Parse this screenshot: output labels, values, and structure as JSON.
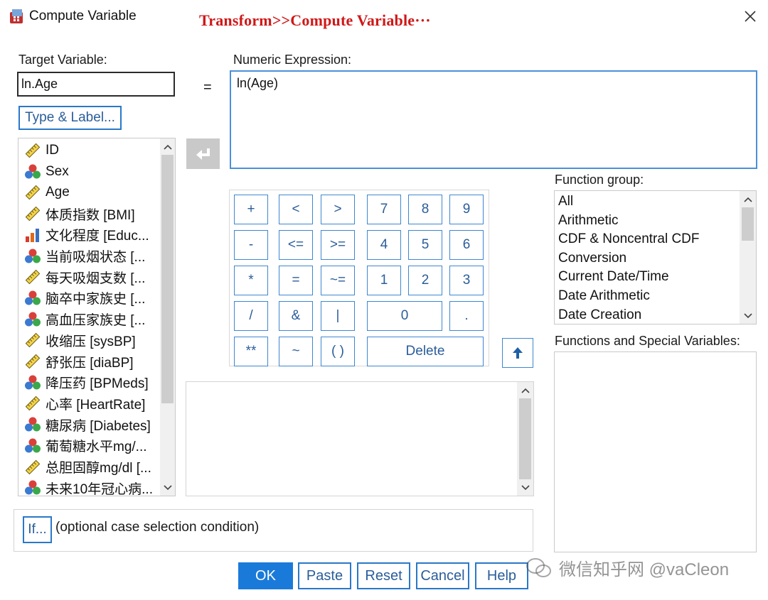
{
  "window": {
    "title": "Compute Variable",
    "annotation": "Transform>>Compute Variable···"
  },
  "target": {
    "label": "Target Variable:",
    "value": "ln.Age",
    "type_label_button": "Type & Label..."
  },
  "equals": "=",
  "expression": {
    "label": "Numeric Expression:",
    "value": "ln(Age)"
  },
  "variables": [
    {
      "label": "ID",
      "icon": "scale-ruler-icon"
    },
    {
      "label": "Sex",
      "icon": "nominal-circles-icon"
    },
    {
      "label": "Age",
      "icon": "scale-ruler-icon"
    },
    {
      "label": "体质指数 [BMI]",
      "icon": "scale-ruler-icon"
    },
    {
      "label": "文化程度 [Educ...",
      "icon": "ordinal-bars-icon"
    },
    {
      "label": "当前吸烟状态 [...",
      "icon": "nominal-circles-icon"
    },
    {
      "label": "每天吸烟支数 [...",
      "icon": "scale-ruler-icon"
    },
    {
      "label": "脑卒中家族史 [...",
      "icon": "nominal-circles-icon"
    },
    {
      "label": "高血压家族史 [...",
      "icon": "nominal-circles-icon"
    },
    {
      "label": "收缩压 [sysBP]",
      "icon": "scale-ruler-icon"
    },
    {
      "label": "舒张压 [diaBP]",
      "icon": "scale-ruler-icon"
    },
    {
      "label": "降压药 [BPMeds]",
      "icon": "nominal-circles-icon"
    },
    {
      "label": "心率 [HeartRate]",
      "icon": "scale-ruler-icon"
    },
    {
      "label": "糖尿病 [Diabetes]",
      "icon": "nominal-circles-icon"
    },
    {
      "label": "葡萄糖水平mg/...",
      "icon": "nominal-circles-icon"
    },
    {
      "label": "总胆固醇mg/dl [...",
      "icon": "scale-ruler-icon"
    },
    {
      "label": "未来10年冠心病...",
      "icon": "nominal-circles-icon"
    }
  ],
  "keypad": {
    "rows": [
      [
        "+",
        "<",
        ">",
        "7",
        "8",
        "9"
      ],
      [
        "-",
        "<=",
        ">=",
        "4",
        "5",
        "6"
      ],
      [
        "*",
        "=",
        "~=",
        "1",
        "2",
        "3"
      ],
      [
        "/",
        "&",
        "|",
        "0",
        "."
      ],
      [
        "**",
        "~",
        "( )",
        "Delete"
      ]
    ]
  },
  "function_group": {
    "label": "Function group:",
    "items": [
      "All",
      "Arithmetic",
      "CDF & Noncentral CDF",
      "Conversion",
      "Current Date/Time",
      "Date Arithmetic",
      "Date Creation"
    ]
  },
  "functions_special": {
    "label": "Functions and Special Variables:"
  },
  "if_condition": {
    "button": "If...",
    "text": "(optional case selection condition)"
  },
  "buttons": {
    "ok": "OK",
    "paste": "Paste",
    "reset": "Reset",
    "cancel": "Cancel",
    "help": "Help"
  },
  "watermark": "微信知乎网 @vaCleon",
  "colors": {
    "accent": "#1a7ad9",
    "annotation": "#d01818",
    "button_border": "#2a78c8"
  }
}
